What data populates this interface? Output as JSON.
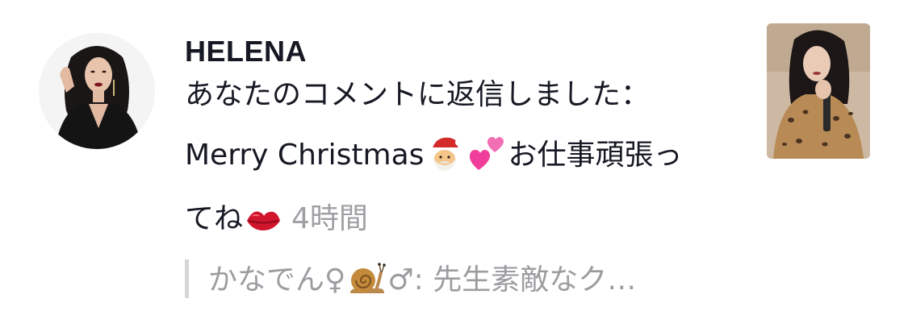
{
  "notification": {
    "username": "HELENA",
    "action_text": "あなたのコメントに返信しました：",
    "reply": {
      "text_1": "Merry Christmas",
      "emoji_1": "santa-face",
      "emoji_2": "two-hearts",
      "text_2": "お仕事頑張っ",
      "text_3": "てね",
      "emoji_3": "kiss-lips"
    },
    "time_ago": "4時間",
    "quoted_comment": {
      "author": "かなでん♀",
      "emoji": "snail",
      "text": "♂: 先生素敵なク…"
    }
  },
  "colors": {
    "primary_text": "#161823",
    "secondary_text": "#a0a0a4",
    "quote_bar": "#d6d6d8",
    "background": "#ffffff"
  }
}
